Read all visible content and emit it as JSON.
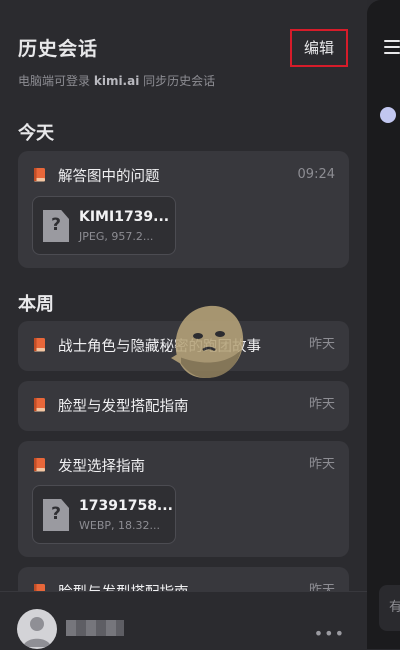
{
  "header": {
    "title": "历史会话",
    "edit_label": "编辑",
    "subtitle_prefix": "电脑端可登录",
    "subtitle_site": "kimi.ai",
    "subtitle_suffix": "同步历史会话"
  },
  "sections": [
    {
      "title": "今天",
      "items": [
        {
          "label": "解答图中的问题",
          "time": "09:24",
          "file": {
            "name": "KIMI1739...",
            "meta": "JPEG, 957.2..."
          }
        }
      ]
    },
    {
      "title": "本周",
      "items": [
        {
          "label": "战士角色与隐藏秘密的跑团故事",
          "time": "昨天"
        },
        {
          "label": "脸型与发型搭配指南",
          "time": "昨天"
        },
        {
          "label": "发型选择指南",
          "time": "昨天",
          "file": {
            "name": "17391758...",
            "meta": "WEBP, 18.32..."
          }
        },
        {
          "label": "脸型与发型搭配指南",
          "time": "昨天"
        }
      ]
    }
  ],
  "main_peek": {
    "input_hint": "有"
  },
  "footer": {
    "more_label": "•••"
  },
  "colors": {
    "accent_book": "#e8673a",
    "edit_border": "#d61c2a"
  },
  "icons": {
    "item": "book-icon",
    "file": "file-question-icon",
    "menu": "hamburger-icon",
    "avatar": "user-avatar-icon",
    "more": "more-dots-icon"
  }
}
